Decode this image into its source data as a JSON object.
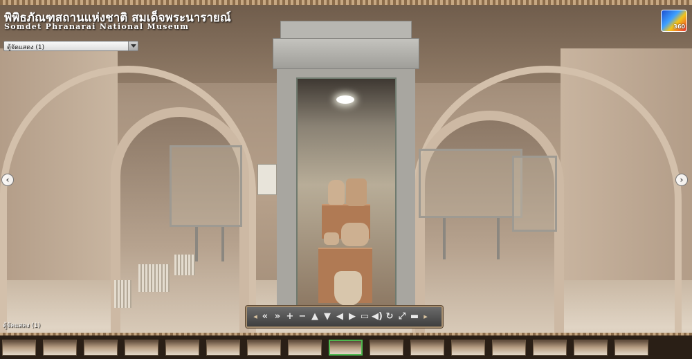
{
  "header": {
    "title_thai": "พิพิธภัณฑสถานแห่งชาติ สมเด็จพระนารายณ์",
    "title_english": "Somdet Phranarai National Museum",
    "logo_text": "360"
  },
  "scene_selector": {
    "selected": "ตู้จัดแสดง (1)"
  },
  "scene_label": "ตู้จัดแสดง (1)",
  "navigation": {
    "prev_glyph": "‹",
    "next_glyph": "›"
  },
  "controls": {
    "left_cap": "◂",
    "right_cap": "▸",
    "buttons": [
      {
        "name": "rewind-icon",
        "glyph": "«"
      },
      {
        "name": "fast-forward-icon",
        "glyph": "»"
      },
      {
        "name": "zoom-in-icon",
        "glyph": "+"
      },
      {
        "name": "zoom-out-icon",
        "glyph": "−"
      },
      {
        "name": "pan-up-icon",
        "glyph": "▲"
      },
      {
        "name": "pan-down-icon",
        "glyph": "▼"
      },
      {
        "name": "pan-left-icon",
        "glyph": "◀"
      },
      {
        "name": "pan-right-icon",
        "glyph": "▶"
      },
      {
        "name": "hotspot-toggle-icon",
        "glyph": "▭"
      },
      {
        "name": "sound-icon",
        "glyph": "◀)"
      },
      {
        "name": "autorotate-icon",
        "glyph": "↻"
      },
      {
        "name": "fullscreen-icon",
        "glyph": "⤢"
      },
      {
        "name": "minimize-icon",
        "glyph": "▬"
      }
    ]
  },
  "thumbnails": {
    "count": 16,
    "active_index": 8
  }
}
